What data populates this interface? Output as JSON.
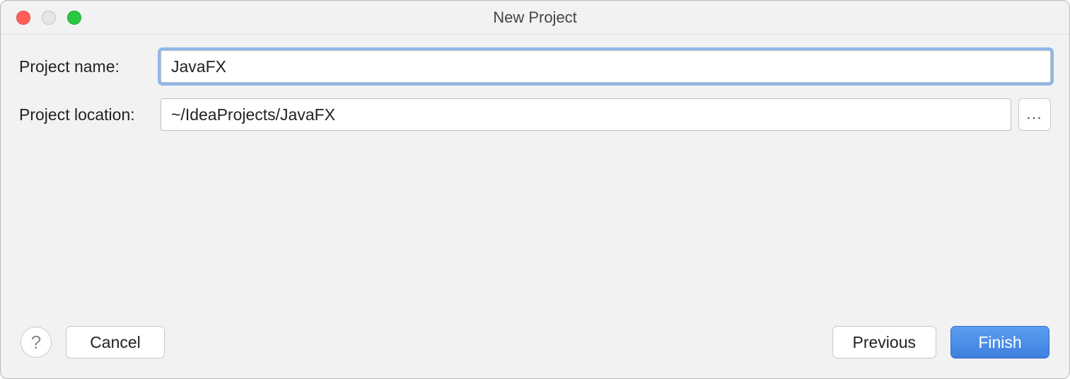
{
  "window": {
    "title": "New Project"
  },
  "form": {
    "project_name_label": "Project name:",
    "project_name_value": "JavaFX",
    "project_location_label": "Project location:",
    "project_location_value": "~/IdeaProjects/JavaFX",
    "browse_label": "..."
  },
  "footer": {
    "help_label": "?",
    "cancel_label": "Cancel",
    "previous_label": "Previous",
    "finish_label": "Finish"
  }
}
